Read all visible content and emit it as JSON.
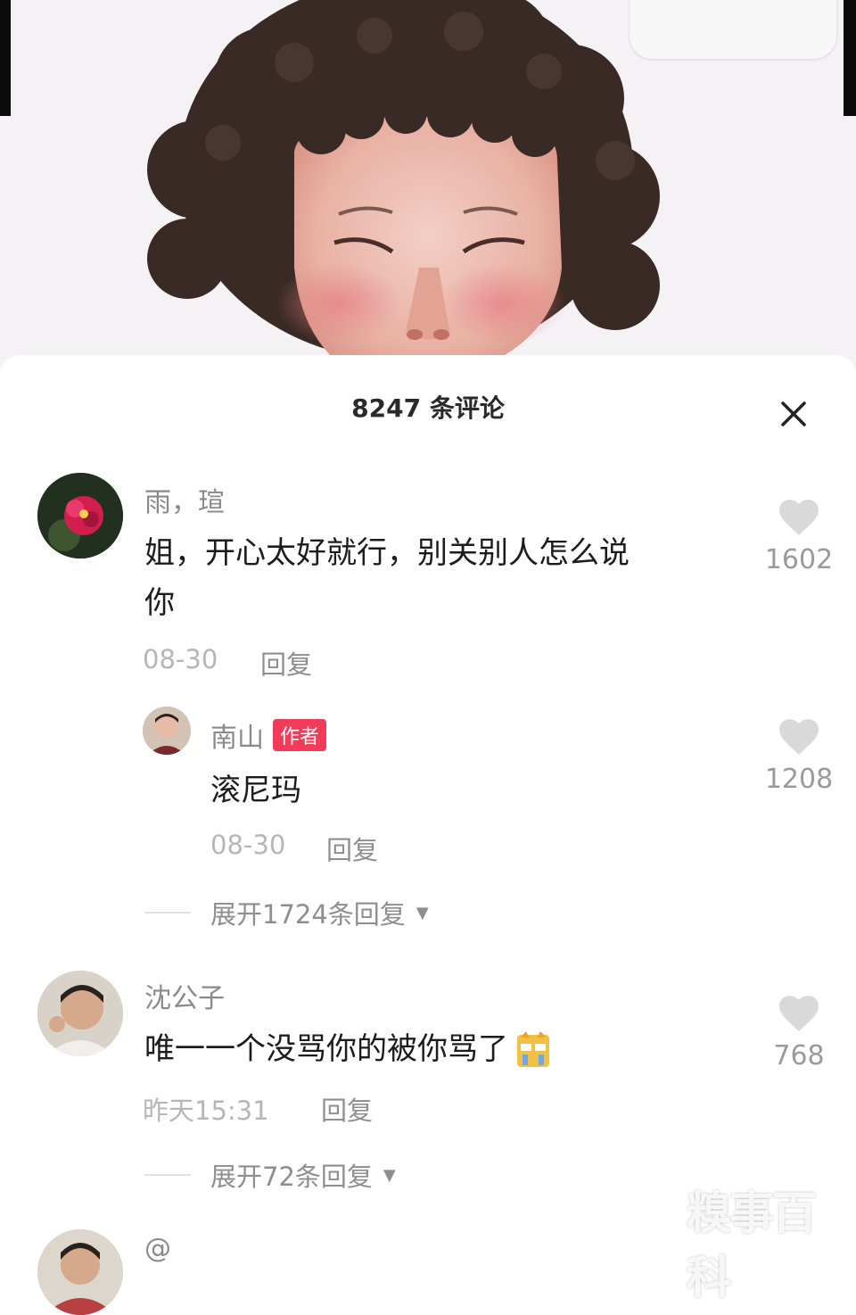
{
  "sheet": {
    "title": "8247 条评论",
    "close_label": "×"
  },
  "comments": [
    {
      "username": "雨，瑄",
      "text_line1": "姐，开心太好就行，别关别人怎么说",
      "text_line2": "你",
      "date": "08-30",
      "reply_label": "回复",
      "likes": "1602"
    },
    {
      "username": "南山",
      "badge": "作者",
      "text": "滚尼玛",
      "date": "08-30",
      "reply_label": "回复",
      "likes": "1208"
    },
    {
      "username": "沈公子",
      "text": "唯一一个没骂你的被你骂了",
      "date": "昨天15:31",
      "reply_label": "回复",
      "likes": "768"
    },
    {
      "username": "@"
    }
  ],
  "expand1": "展开1724条回复",
  "expand2": "展开72条回复",
  "watermark": "糗事百科",
  "colors": {
    "badge": "#f23a59",
    "heart": "#d9d9d9"
  }
}
